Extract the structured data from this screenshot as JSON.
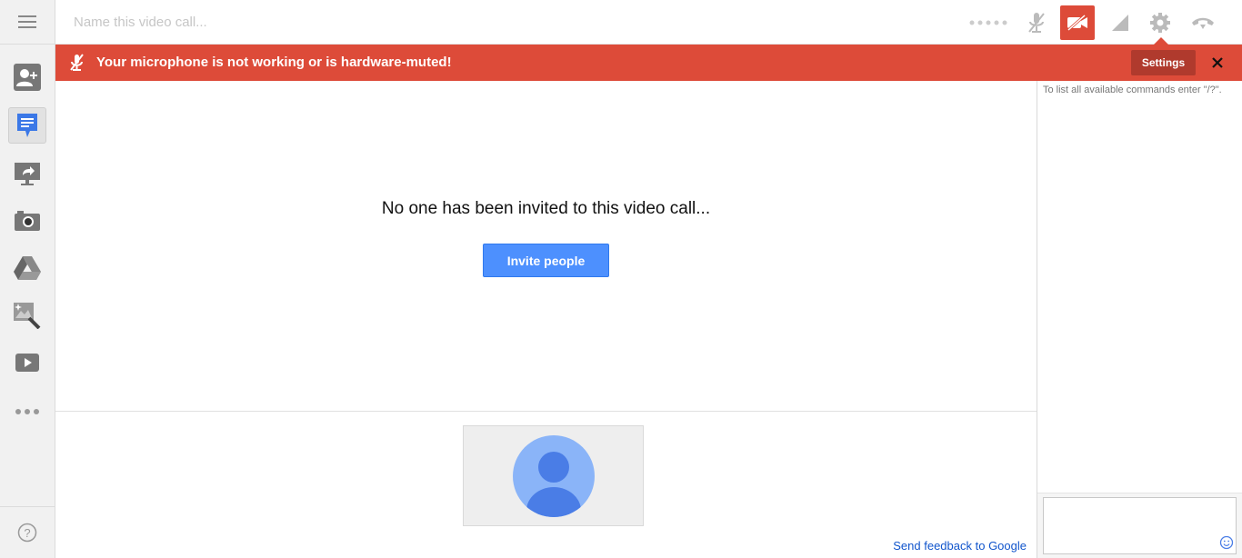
{
  "topbar": {
    "title_placeholder": "Name this video call...",
    "icons": [
      "signal-dots-icon",
      "mic-muted-icon",
      "camera-off-icon",
      "bandwidth-icon",
      "settings-gear-icon",
      "hang-up-icon"
    ]
  },
  "sidebar": {
    "items": [
      {
        "icon": "add-person-icon"
      },
      {
        "icon": "chat-icon",
        "active": true
      },
      {
        "icon": "screenshare-icon"
      },
      {
        "icon": "camera-icon"
      },
      {
        "icon": "google-drive-icon"
      },
      {
        "icon": "effects-icon"
      },
      {
        "icon": "youtube-icon"
      },
      {
        "icon": "more-apps-icon"
      }
    ],
    "help_label": "?"
  },
  "banner": {
    "message": "Your microphone is not working or is hardware-muted!",
    "settings_label": "Settings",
    "close_label": "✕",
    "color": "#dd4b39"
  },
  "main": {
    "empty_message": "No one has been invited to this video call...",
    "invite_label": "Invite people",
    "feedback_label": "Send feedback to Google"
  },
  "chat": {
    "hint": "To list all available commands enter \"/?\"."
  },
  "colors": {
    "accent_red": "#dd4b39",
    "button_blue": "#4d90fe",
    "avatar_bg": "#8ab4f8",
    "avatar_fg": "#4a7de6",
    "link_blue": "#1155cc"
  }
}
